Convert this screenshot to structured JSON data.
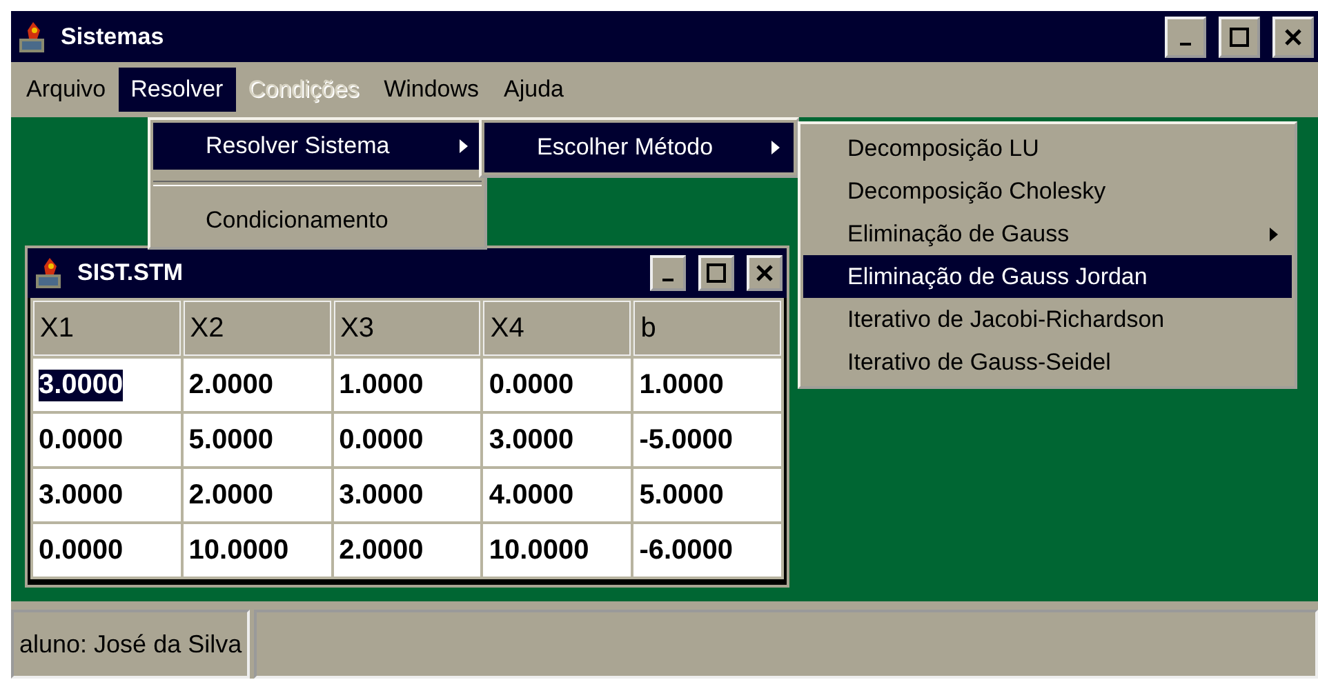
{
  "window": {
    "title": "Sistemas"
  },
  "menubar": [
    {
      "label": "Arquivo",
      "selected": false,
      "disabled": false
    },
    {
      "label": "Resolver",
      "selected": true,
      "disabled": false
    },
    {
      "label": "Condições",
      "selected": false,
      "disabled": true
    },
    {
      "label": "Windows",
      "selected": false,
      "disabled": false
    },
    {
      "label": "Ajuda",
      "selected": false,
      "disabled": false
    }
  ],
  "menus": [
    {
      "items": [
        {
          "kind": "item",
          "label": "Resolver Sistema",
          "selected": true,
          "submenu": true
        },
        {
          "kind": "separator"
        },
        {
          "kind": "item",
          "label": "Condicionamento",
          "selected": false,
          "submenu": false
        }
      ]
    },
    {
      "items": [
        {
          "kind": "item",
          "label": "Escolher Método",
          "selected": true,
          "submenu": true
        }
      ]
    },
    {
      "items": [
        {
          "kind": "item",
          "label": "Decomposição LU",
          "selected": false,
          "submenu": false
        },
        {
          "kind": "item",
          "label": "Decomposição Cholesky",
          "selected": false,
          "submenu": false
        },
        {
          "kind": "item",
          "label": "Eliminação de Gauss",
          "selected": false,
          "submenu": true
        },
        {
          "kind": "item",
          "label": "Eliminação de Gauss Jordan",
          "selected": true,
          "submenu": false
        },
        {
          "kind": "item",
          "label": "Iterativo de Jacobi-Richardson",
          "selected": false,
          "submenu": false
        },
        {
          "kind": "item",
          "label": "Iterativo de Gauss-Seidel",
          "selected": false,
          "submenu": false
        }
      ]
    }
  ],
  "child_window": {
    "title": "SIST.STM",
    "table": {
      "columns": [
        "X1",
        "X2",
        "X3",
        "X4",
        "b"
      ],
      "rows": [
        [
          {
            "text": "3.0000",
            "selected": true
          },
          {
            "text": "2.0000",
            "selected": false
          },
          {
            "text": "1.0000",
            "selected": false
          },
          {
            "text": "0.0000",
            "selected": false
          },
          {
            "text": "1.0000",
            "selected": false
          }
        ],
        [
          {
            "text": "0.0000",
            "selected": false
          },
          {
            "text": "5.0000",
            "selected": false
          },
          {
            "text": "0.0000",
            "selected": false
          },
          {
            "text": "3.0000",
            "selected": false
          },
          {
            "text": "-5.0000",
            "selected": false
          }
        ],
        [
          {
            "text": "3.0000",
            "selected": false
          },
          {
            "text": "2.0000",
            "selected": false
          },
          {
            "text": "3.0000",
            "selected": false
          },
          {
            "text": "4.0000",
            "selected": false
          },
          {
            "text": "5.0000",
            "selected": false
          }
        ],
        [
          {
            "text": "0.0000",
            "selected": false
          },
          {
            "text": "10.0000",
            "selected": false
          },
          {
            "text": "2.0000",
            "selected": false
          },
          {
            "text": "10.0000",
            "selected": false
          },
          {
            "text": "-6.0000",
            "selected": false
          }
        ]
      ]
    }
  },
  "status_bar": {
    "text": "aluno: José da Silva"
  }
}
